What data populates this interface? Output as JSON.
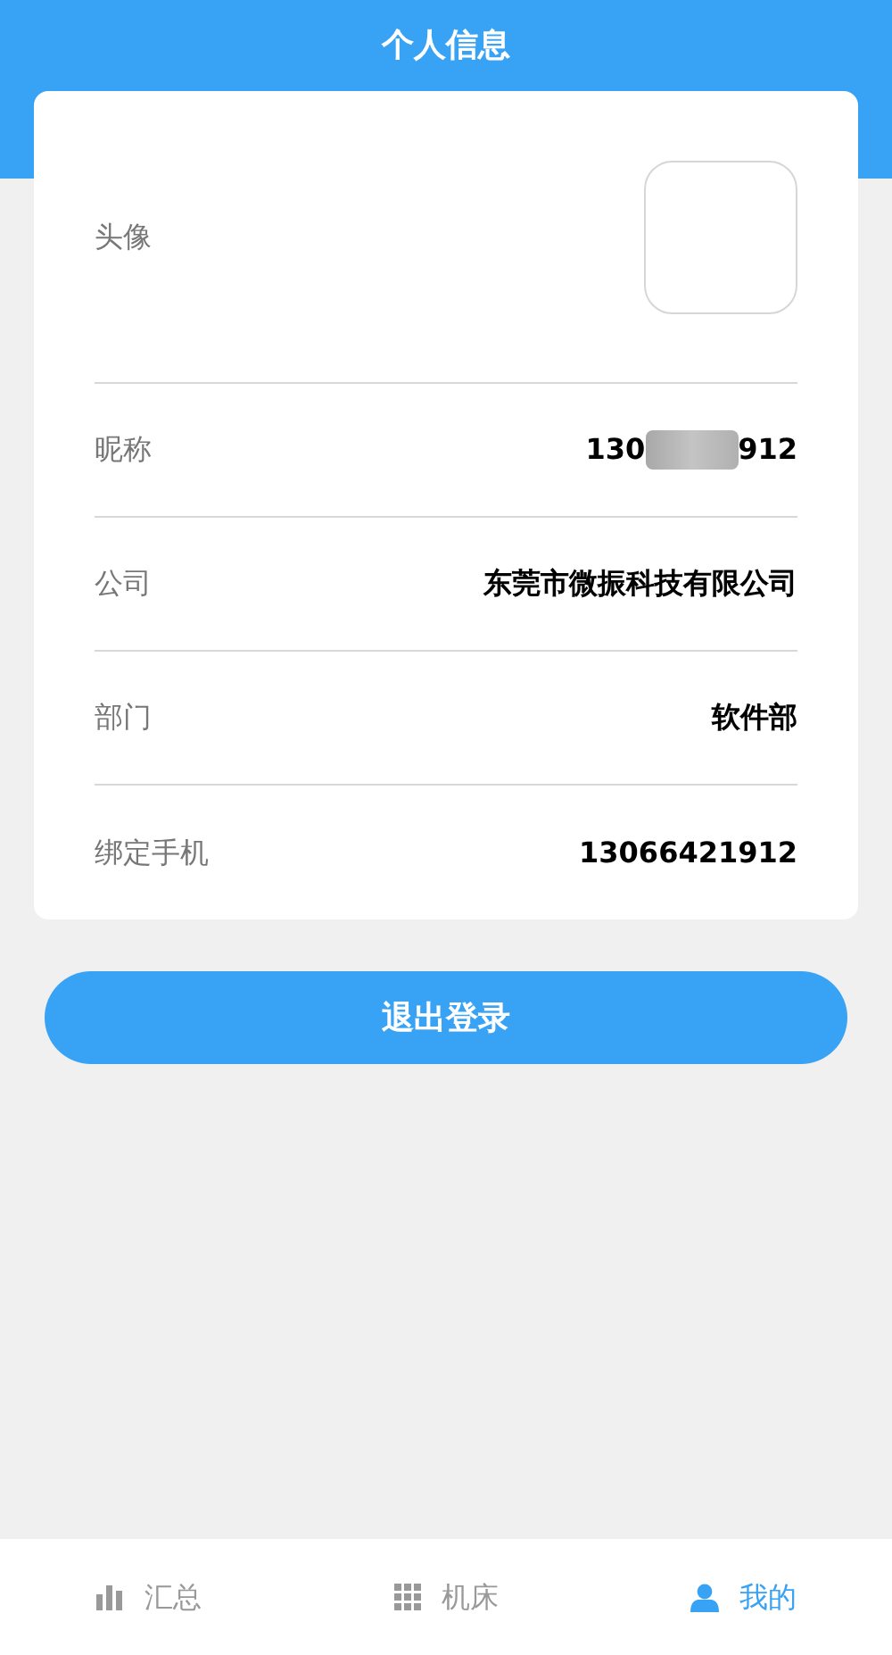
{
  "header": {
    "title": "个人信息"
  },
  "profile": [
    {
      "kind": "avatar",
      "label": "头像"
    },
    {
      "kind": "redacted",
      "label": "昵称",
      "value_start": "130",
      "value_end": "912"
    },
    {
      "kind": "text",
      "label": "公司",
      "value": "东莞市微振科技有限公司"
    },
    {
      "kind": "text",
      "label": "部门",
      "value": "软件部"
    },
    {
      "kind": "text",
      "label": "绑定手机",
      "value": "13066421912"
    }
  ],
  "logout_button": "退出登录",
  "tabs": [
    {
      "kind": "chart",
      "label": "汇总",
      "selected": false
    },
    {
      "kind": "grid",
      "label": "机床",
      "selected": false
    },
    {
      "kind": "person",
      "label": "我的",
      "selected": true
    }
  ]
}
